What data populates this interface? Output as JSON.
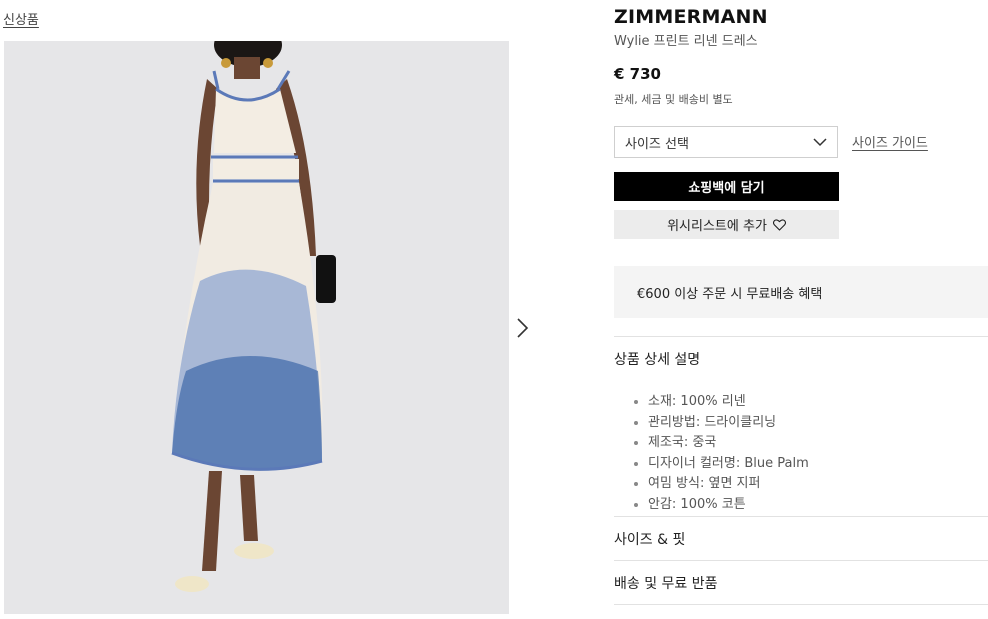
{
  "new_arrivals_label": "신상품",
  "product": {
    "brand": "ZIMMERMANN",
    "name": "Wylie 프린트 리넨 드레스",
    "price": "€ 730",
    "tax_note": "관세, 세금 및 배송비 별도"
  },
  "size_select": {
    "placeholder": "사이즈 선택"
  },
  "size_guide_label": "사이즈 가이드",
  "add_to_bag_label": "쇼핑백에 담기",
  "wishlist_label": "위시리스트에 추가",
  "promo_text": "€600 이상 주문 시 무료배송 혜택",
  "sections": {
    "details_title": "상품 상세 설명",
    "details": [
      "소재: 100% 리넨",
      "관리방법: 드라이클리닝",
      "제조국: 중국",
      "디자이너 컬러명: Blue Palm",
      "여밈 방식: 옆면 지퍼",
      "안감: 100% 코튼"
    ],
    "size_fit_title": "사이즈 & 핏",
    "shipping_title": "배송 및 무료 반품"
  },
  "icons": {
    "next": "chevron-right-icon",
    "dropdown": "chevron-down-icon",
    "wishlist": "heart-icon"
  },
  "colors": {
    "primary_button": "#000000",
    "secondary_button": "#ececec",
    "promo_background": "#f4f4f4",
    "dress_print": "#3f68a8"
  }
}
